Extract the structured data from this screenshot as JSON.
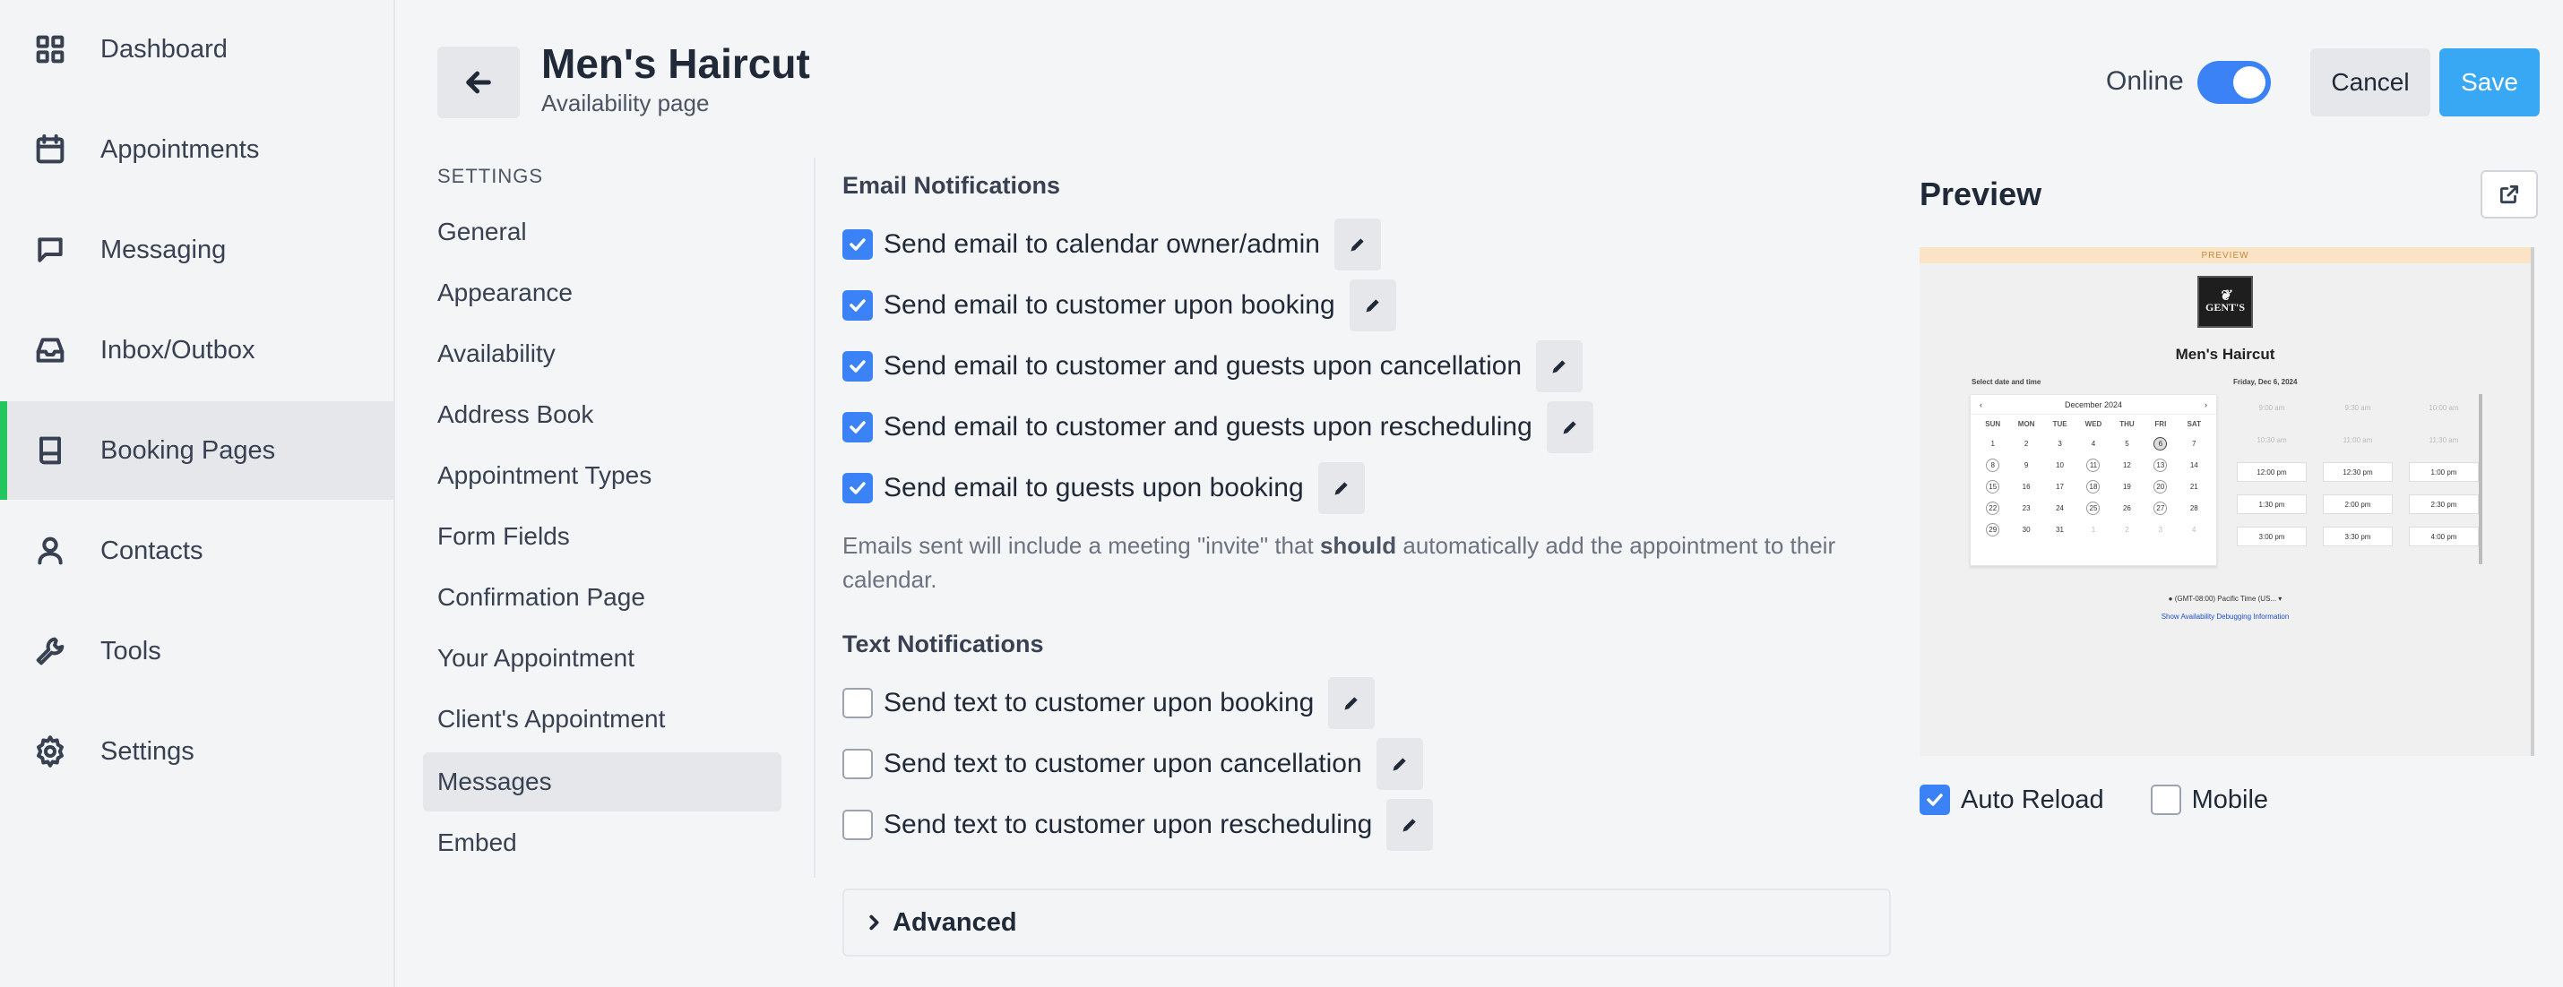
{
  "sidebar": {
    "items": [
      {
        "label": "Dashboard",
        "icon": "dashboard-icon"
      },
      {
        "label": "Appointments",
        "icon": "calendar-icon"
      },
      {
        "label": "Messaging",
        "icon": "message-icon"
      },
      {
        "label": "Inbox/Outbox",
        "icon": "inbox-icon"
      },
      {
        "label": "Booking Pages",
        "icon": "book-icon",
        "active": true
      },
      {
        "label": "Contacts",
        "icon": "user-icon"
      },
      {
        "label": "Tools",
        "icon": "wrench-icon"
      },
      {
        "label": "Settings",
        "icon": "gear-icon"
      }
    ]
  },
  "header": {
    "title": "Men's Haircut",
    "subtitle": "Availability page",
    "online_label": "Online",
    "online": true,
    "cancel_label": "Cancel",
    "save_label": "Save"
  },
  "settings_nav": {
    "heading": "SETTINGS",
    "items": [
      "General",
      "Appearance",
      "Availability",
      "Address Book",
      "Appointment Types",
      "Form Fields",
      "Confirmation Page",
      "Your Appointment",
      "Client's Appointment",
      "Messages",
      "Embed"
    ],
    "active": "Messages"
  },
  "email": {
    "title": "Email Notifications",
    "items": [
      {
        "label": "Send email to calendar owner/admin",
        "checked": true
      },
      {
        "label": "Send email to customer upon booking",
        "checked": true
      },
      {
        "label": "Send email to customer and guests upon cancellation",
        "checked": true
      },
      {
        "label": "Send email to customer and guests upon rescheduling",
        "checked": true
      },
      {
        "label": "Send email to guests upon booking",
        "checked": true
      }
    ],
    "note_pre": "Emails sent will include a meeting \"invite\" that ",
    "note_bold": "should",
    "note_post": " automatically add the appointment to their calendar."
  },
  "text": {
    "title": "Text Notifications",
    "items": [
      {
        "label": "Send text to customer upon booking",
        "checked": false
      },
      {
        "label": "Send text to customer upon cancellation",
        "checked": false
      },
      {
        "label": "Send text to customer upon rescheduling",
        "checked": false
      }
    ]
  },
  "advanced_label": "Advanced",
  "preview": {
    "title": "Preview",
    "banner": "PREVIEW",
    "logo_line1": "GENT'S",
    "page_title": "Men's Haircut",
    "select_label": "Select date and time",
    "date_label": "Friday, Dec 6, 2024",
    "month": "December 2024",
    "dow": [
      "SUN",
      "MON",
      "TUE",
      "WED",
      "THU",
      "FRI",
      "SAT"
    ],
    "times": [
      "9:00 am",
      "9:30 am",
      "10:00 am",
      "10:30 am",
      "11:00 am",
      "11:30 am",
      "12:00 pm",
      "12:30 pm",
      "1:00 pm",
      "1:30 pm",
      "2:00 pm",
      "2:30 pm",
      "3:00 pm",
      "3:30 pm",
      "4:00 pm"
    ],
    "timezone": "(GMT-08:00) Pacific Time (US...",
    "debug_link": "Show Availability Debugging Information",
    "auto_reload_label": "Auto Reload",
    "auto_reload": true,
    "mobile_label": "Mobile",
    "mobile": false
  },
  "colors": {
    "accent": "#3b82f6",
    "save": "#38a8f5",
    "active_indicator": "#22c55e"
  }
}
